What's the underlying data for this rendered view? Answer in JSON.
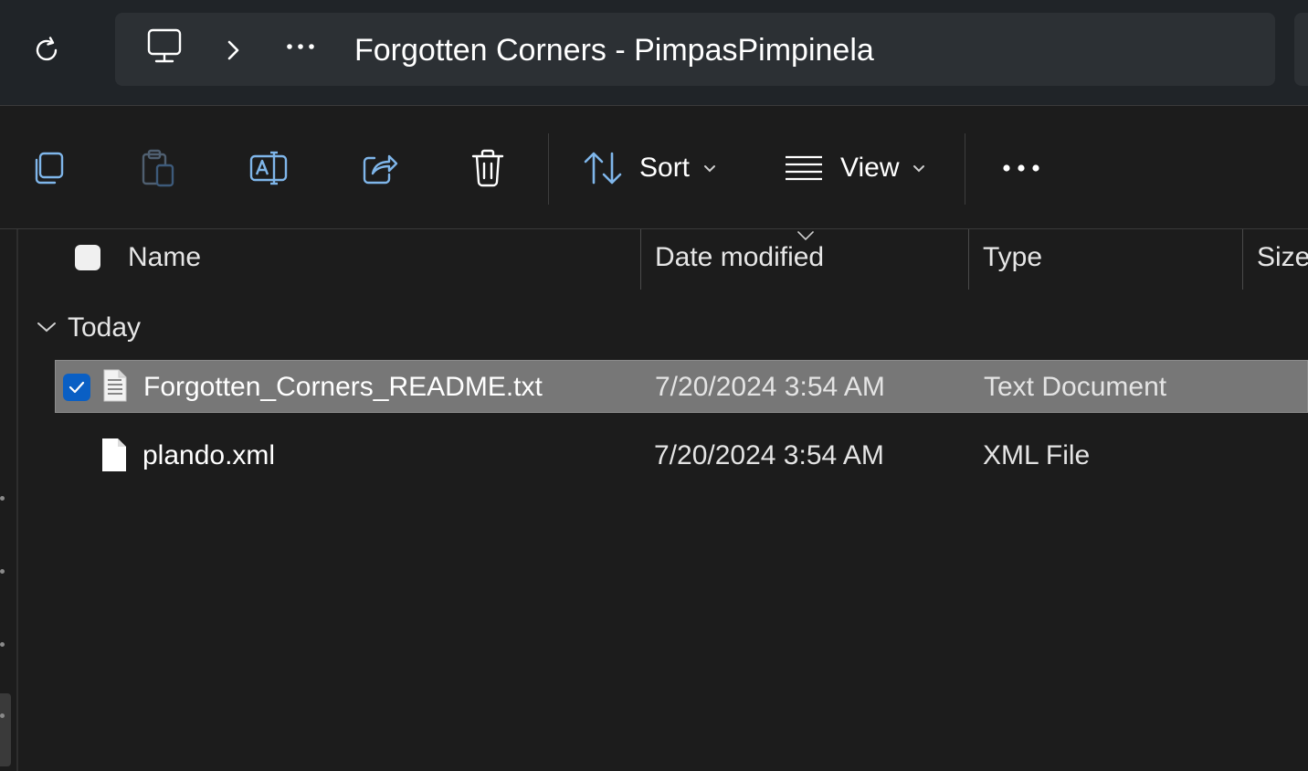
{
  "address": {
    "refresh_icon": "refresh-icon",
    "location_icon": "this-pc-icon",
    "chevron_icon": "chevron-right-icon",
    "overflow_icon": "more-horizontal-icon",
    "title": "Forgotten Corners - PimpasPimpinela"
  },
  "toolbar": {
    "copy_icon": "copy-icon",
    "paste_icon": "paste-icon",
    "rename_icon": "rename-icon",
    "share_icon": "share-icon",
    "delete_icon": "delete-icon",
    "sort_label": "Sort",
    "view_label": "View",
    "more_icon": "more-horizontal-icon"
  },
  "columns": {
    "name": "Name",
    "date": "Date modified",
    "type": "Type",
    "size": "Size"
  },
  "group": {
    "label": "Today"
  },
  "files": [
    {
      "name": "Forgotten_Corners_README.txt",
      "date": "7/20/2024 3:54 AM",
      "type": "Text Document",
      "selected": true,
      "icon": "text-document-icon"
    },
    {
      "name": "plando.xml",
      "date": "7/20/2024 3:54 AM",
      "type": "XML File",
      "selected": false,
      "icon": "file-icon"
    }
  ],
  "colors": {
    "accent": "#0a5fc4",
    "selection": "#777777",
    "background": "#1c1c1c",
    "addressbar": "#202428"
  }
}
